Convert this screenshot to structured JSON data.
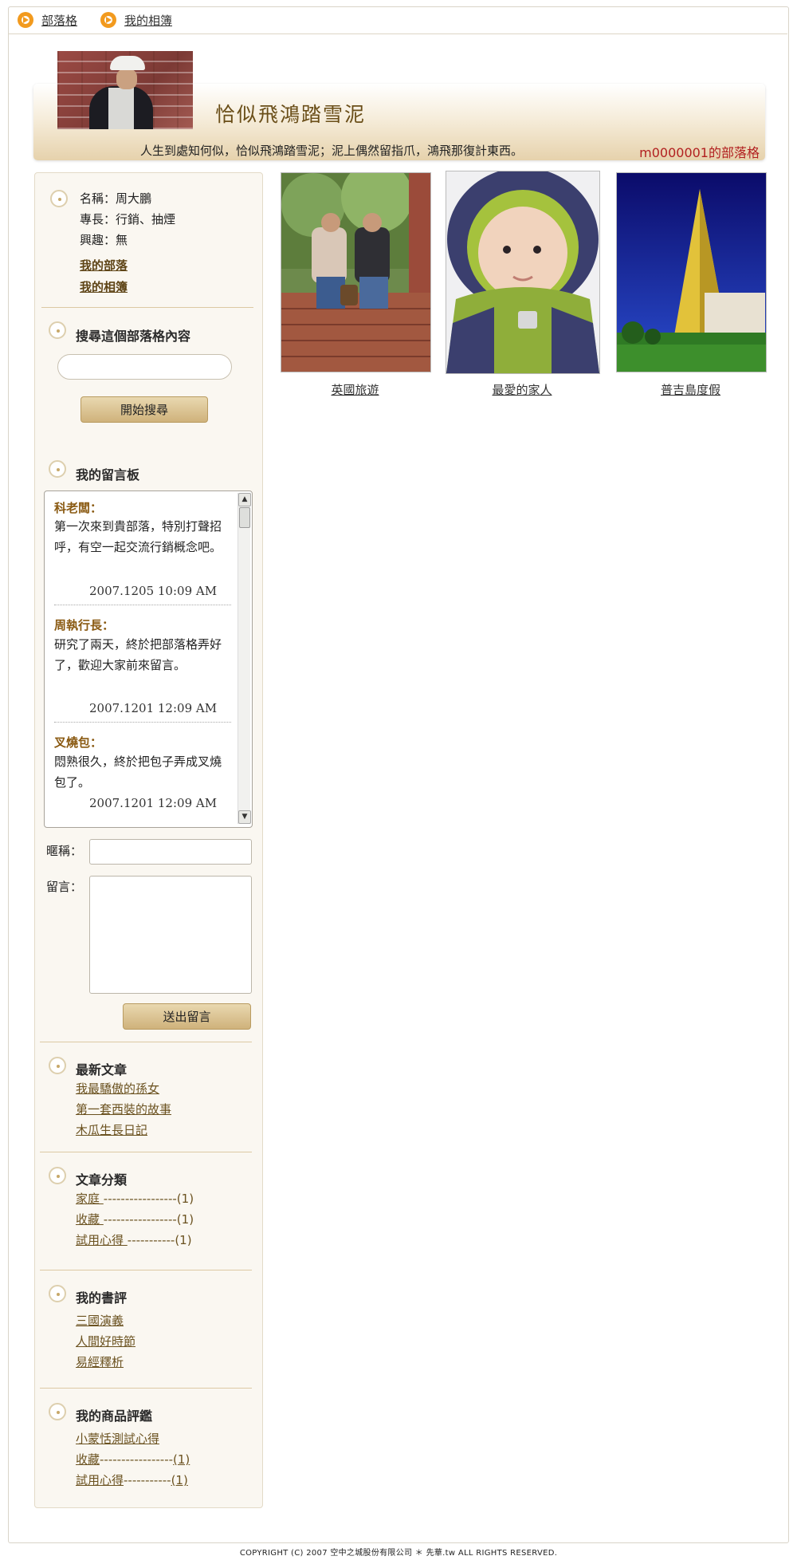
{
  "topnav": {
    "blog": "部落格",
    "album": "我的相簿"
  },
  "header": {
    "title": "恰似飛鴻踏雪泥",
    "tagline": "人生到處知何似，恰似飛鴻踏雪泥；泥上偶然留指爪，鴻飛那復計東西。",
    "owner": "m0000001的部落格"
  },
  "profile": {
    "name": "名稱：周大鵬",
    "specialty": "專長：行銷、抽煙",
    "hobby": "興趣：無",
    "links": [
      "我的部落",
      "我的相簿"
    ]
  },
  "search": {
    "title": "搜尋這個部落格內容",
    "placeholder": "",
    "button": "開始搜尋"
  },
  "guestbook": {
    "title": "我的留言板",
    "messages": [
      {
        "name": "科老闆：",
        "text": "第一次來到貴部落，特別打聲招呼，有空一起交流行銷概念吧。",
        "time": "2007.1205 10:09 AM"
      },
      {
        "name": "周執行長：",
        "text": "研究了兩天，終於把部落格弄好了，歡迎大家前來留言。",
        "time": "2007.1201 12:09 AM"
      },
      {
        "name": "叉燒包：",
        "text": "悶熟很久，終於把包子弄成叉燒包了。",
        "time": "2007.1201 12:09 AM"
      }
    ],
    "nickname_label": "暱稱：",
    "message_label": "留言：",
    "submit": "送出留言"
  },
  "latest": {
    "title": "最新文章",
    "items": [
      "我最驕傲的孫女",
      "第一套西裝的故事",
      "木瓜生長日記"
    ]
  },
  "categories": {
    "title": "文章分類",
    "items": [
      {
        "label": "家庭 ",
        "dashes": "-----------------",
        "count": "(1)"
      },
      {
        "label": "收藏 ",
        "dashes": "-----------------",
        "count": "(1)"
      },
      {
        "label": "試用心得 ",
        "dashes": "-----------",
        "count": "(1)"
      }
    ]
  },
  "reviews": {
    "title": "我的書評",
    "items": [
      "三國演義",
      "人間好時節",
      "易經釋析"
    ]
  },
  "products": {
    "title": "我的商品評鑑",
    "items": [
      {
        "label": "小蒙恬測試心得",
        "dashes": "",
        "count": ""
      },
      {
        "label": "收藏",
        "dashes": "-----------------",
        "count": "(1)"
      },
      {
        "label": "試用心得",
        "dashes": "-----------",
        "count": "(1)"
      }
    ]
  },
  "albums": [
    {
      "caption": "英國旅遊"
    },
    {
      "caption": "最愛的家人"
    },
    {
      "caption": "普吉島度假"
    }
  ],
  "footer": "COPYRIGHT (C) 2007 空中之城股份有限公司 ＊ 先華.tw ALL RIGHTS RESERVED.",
  "colors": {
    "accent_gold": "#c9ad74",
    "link_brown": "#6b5220",
    "owner_red": "#b22020",
    "nav_orange": "#f29a1e"
  }
}
